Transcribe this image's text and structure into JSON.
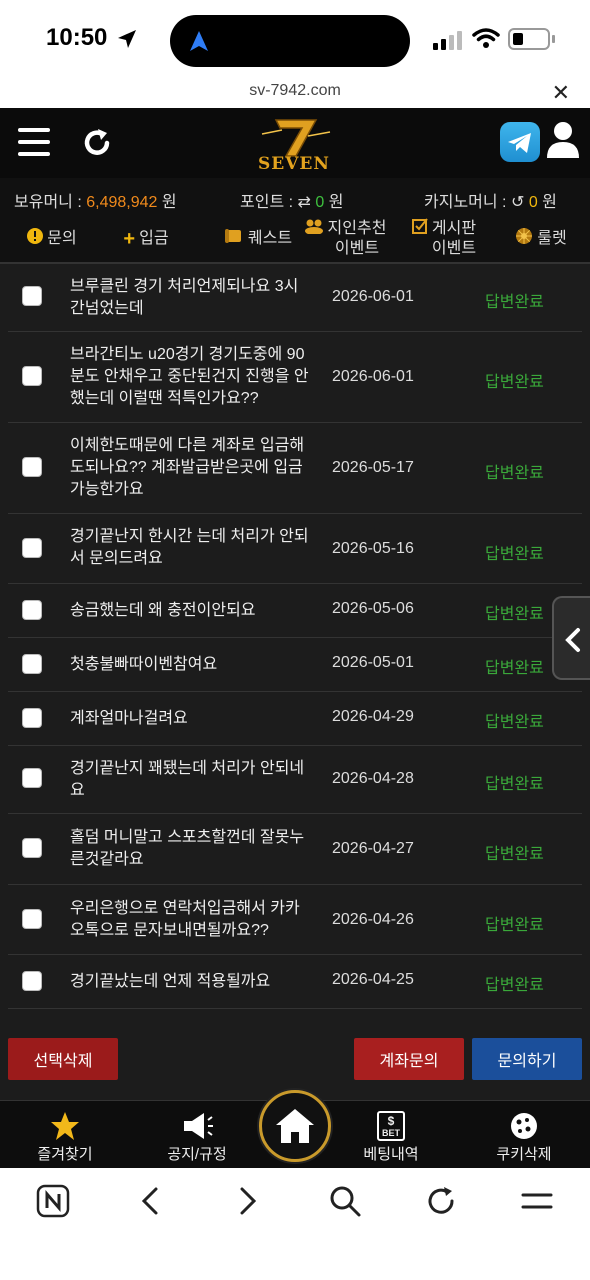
{
  "status_bar": {
    "time": "10:50"
  },
  "browser": {
    "url": "sv-7942.com"
  },
  "header": {
    "logo_text": "SEVEN",
    "logo_numeral": "7"
  },
  "balances": {
    "money_label": "보유머니 :",
    "money_value": "6,498,942",
    "money_unit": "원",
    "points_label": "포인트 :",
    "points_value": "0",
    "points_unit": "원",
    "casino_label": "카지노머니 :",
    "casino_value": "0",
    "casino_unit": "원"
  },
  "tabs": [
    {
      "label": "문의",
      "icon": "exclamation-icon"
    },
    {
      "label": "입금",
      "icon": "plus-icon"
    },
    {
      "label": "퀘스트",
      "icon": "scroll-icon"
    },
    {
      "label": "지인추천\n이벤트",
      "icon": "people-icon"
    },
    {
      "label": "게시판\n이벤트",
      "icon": "checkbox-icon"
    },
    {
      "label": "룰렛",
      "icon": "roulette-icon"
    }
  ],
  "inquiries": [
    {
      "title": "브루클린 경기 처리언제되나요 3시간넘었는데",
      "date": "2026-06-01",
      "status": "답변완료"
    },
    {
      "title": "브라간티노 u20경기 경기도중에 90분도 안채우고 중단된건지 진행을 안했는데 이럴땐 적특인가요??",
      "date": "2026-06-01",
      "status": "답변완료"
    },
    {
      "title": "이체한도때문에 다른 계좌로 입금해도되나요?? 계좌발급받은곳에 입금가능한가요",
      "date": "2026-05-17",
      "status": "답변완료"
    },
    {
      "title": "경기끝난지 한시간   는데 처리가 안되서 문의드려요",
      "date": "2026-05-16",
      "status": "답변완료"
    },
    {
      "title": "송금했는데 왜 충전이안되요",
      "date": "2026-05-06",
      "status": "답변완료"
    },
    {
      "title": "첫충불빠따이벤참여요",
      "date": "2026-05-01",
      "status": "답변완료"
    },
    {
      "title": "계좌얼마나걸려요",
      "date": "2026-04-29",
      "status": "답변완료"
    },
    {
      "title": "경기끝난지 꽤됐는데 처리가 안되네요",
      "date": "2026-04-28",
      "status": "답변완료"
    },
    {
      "title": "홀덤 머니말고 스포츠할껀데 잘못누른것같라요",
      "date": "2026-04-27",
      "status": "답변완료"
    },
    {
      "title": "우리은행으로 연락처입금해서 카카오톡으로 문자보내면될까요??",
      "date": "2026-04-26",
      "status": "답변완료"
    },
    {
      "title": "경기끝났는데 언제 적용될까요",
      "date": "2026-04-25",
      "status": "답변완료"
    }
  ],
  "actions": {
    "delete_selected": "선택삭제",
    "account_inquiry": "계좌문의",
    "ask": "문의하기"
  },
  "bottom_nav": {
    "favorites": "즐겨찾기",
    "notice": "공지/규정",
    "bet_history": "베팅내역",
    "bet_badge": "BET",
    "cookie_delete": "쿠키삭제"
  },
  "colors": {
    "accent_orange": "#f08a1c",
    "status_green": "#3aa83a",
    "delete_red": "#9b1b1b",
    "ask_blue": "#1b4f9b"
  }
}
